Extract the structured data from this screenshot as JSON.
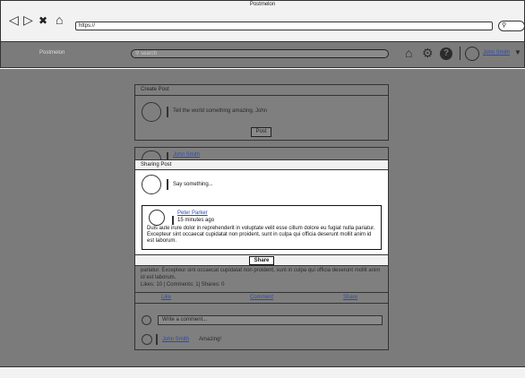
{
  "window": {
    "title": "Postmelon",
    "url": "https://"
  },
  "app": {
    "title": "Postmelon",
    "search_placeholder": "search",
    "user_name": "John Smith"
  },
  "create_post": {
    "header": "Create Post",
    "placeholder": "Tell the world something amazing, John",
    "post_label": "Post"
  },
  "feed_post": {
    "author": "John Smith",
    "text_visible": "pariatur. Excepteur sint occaecat cupidatat non proident, sunt in culpa qui officia deserunt mollit anim id est laborum.",
    "stats": "Likes: 10 | Comments: 1| Shares: 0",
    "like_label": "Like",
    "comment_label": "Comment",
    "share_label": "Share",
    "comment_placeholder": "Write a comment...",
    "comment_author": "John Smith",
    "comment_text": "Amazing!"
  },
  "modal": {
    "title": "Sharing Post",
    "placeholder": "Say something...",
    "quoted_author": "Peter Parker",
    "quoted_time": "15 minutes ago",
    "quoted_text": "Duis aute irure dolor in reprehenderit in voluptate velit esse cillum dolore eu fugiat nulla pariatur. Excepteur sint occaecat cupidatat non proident, sunt in culpa qui officia deserunt mollit anim id est laborum.",
    "share_button": "Share"
  },
  "icons": {
    "back": "back-arrow-icon",
    "forward": "forward-arrow-icon",
    "close": "close-icon",
    "home": "home-icon",
    "settings": "gear-icon",
    "help": "question-icon",
    "search": "search-icon"
  }
}
